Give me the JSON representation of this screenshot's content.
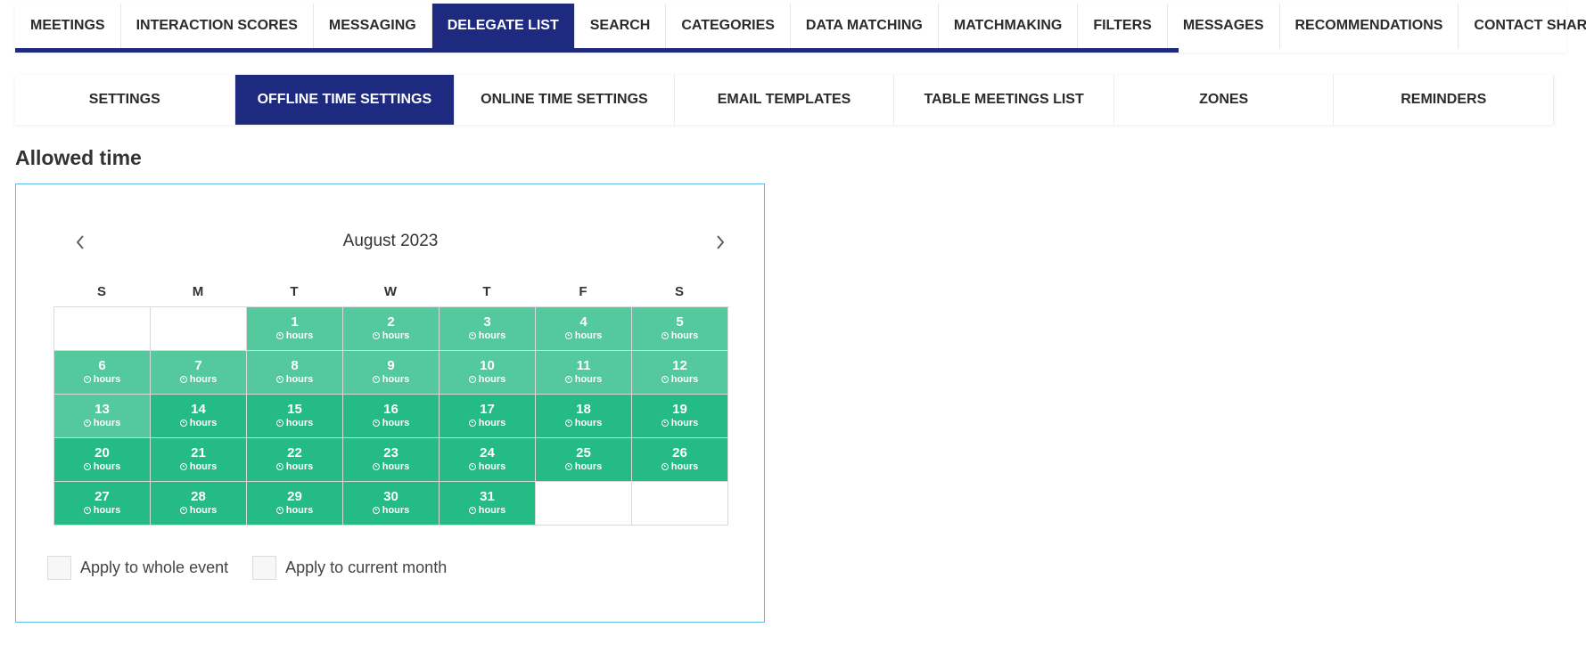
{
  "top_tabs": [
    {
      "label": "MEETINGS",
      "active": false
    },
    {
      "label": "INTERACTION SCORES",
      "active": false
    },
    {
      "label": "MESSAGING",
      "active": false
    },
    {
      "label": "DELEGATE LIST",
      "active": true
    },
    {
      "label": "SEARCH",
      "active": false
    },
    {
      "label": "CATEGORIES",
      "active": false
    },
    {
      "label": "DATA MATCHING",
      "active": false
    },
    {
      "label": "MATCHMAKING",
      "active": false
    },
    {
      "label": "FILTERS",
      "active": false
    },
    {
      "label": "MESSAGES",
      "active": false
    },
    {
      "label": "RECOMMENDATIONS",
      "active": false
    },
    {
      "label": "CONTACT SHARING",
      "active": false
    }
  ],
  "sub_tabs": [
    {
      "label": "SETTINGS",
      "active": false
    },
    {
      "label": "OFFLINE TIME SETTINGS",
      "active": true
    },
    {
      "label": "ONLINE TIME SETTINGS",
      "active": false
    },
    {
      "label": "EMAIL TEMPLATES",
      "active": false
    },
    {
      "label": "TABLE MEETINGS LIST",
      "active": false
    },
    {
      "label": "ZONES",
      "active": false
    },
    {
      "label": "REMINDERS",
      "active": false
    }
  ],
  "section_title": "Allowed time",
  "calendar": {
    "month_label": "August 2023",
    "weekdays": [
      "S",
      "M",
      "T",
      "W",
      "T",
      "F",
      "S"
    ],
    "hours_label": "hours",
    "days": [
      {
        "day": "",
        "state": "empty"
      },
      {
        "day": "",
        "state": "empty"
      },
      {
        "day": "1",
        "state": "light"
      },
      {
        "day": "2",
        "state": "light"
      },
      {
        "day": "3",
        "state": "light"
      },
      {
        "day": "4",
        "state": "light"
      },
      {
        "day": "5",
        "state": "light"
      },
      {
        "day": "6",
        "state": "light"
      },
      {
        "day": "7",
        "state": "light"
      },
      {
        "day": "8",
        "state": "light"
      },
      {
        "day": "9",
        "state": "light"
      },
      {
        "day": "10",
        "state": "light"
      },
      {
        "day": "11",
        "state": "light"
      },
      {
        "day": "12",
        "state": "light"
      },
      {
        "day": "13",
        "state": "light"
      },
      {
        "day": "14",
        "state": "dark"
      },
      {
        "day": "15",
        "state": "dark"
      },
      {
        "day": "16",
        "state": "dark"
      },
      {
        "day": "17",
        "state": "dark"
      },
      {
        "day": "18",
        "state": "dark"
      },
      {
        "day": "19",
        "state": "dark"
      },
      {
        "day": "20",
        "state": "dark"
      },
      {
        "day": "21",
        "state": "dark"
      },
      {
        "day": "22",
        "state": "dark"
      },
      {
        "day": "23",
        "state": "dark"
      },
      {
        "day": "24",
        "state": "dark"
      },
      {
        "day": "25",
        "state": "dark"
      },
      {
        "day": "26",
        "state": "dark"
      },
      {
        "day": "27",
        "state": "dark"
      },
      {
        "day": "28",
        "state": "dark"
      },
      {
        "day": "29",
        "state": "dark"
      },
      {
        "day": "30",
        "state": "dark"
      },
      {
        "day": "31",
        "state": "dark"
      },
      {
        "day": "",
        "state": "empty"
      },
      {
        "day": "",
        "state": "empty"
      }
    ]
  },
  "options": {
    "whole_event_label": "Apply to whole event",
    "current_month_label": "Apply to current month"
  },
  "colors": {
    "accent": "#1d2a7f",
    "light_green": "#54c99d",
    "dark_green": "#24bb84",
    "panel_border": "#5bb8e8"
  },
  "icons": {
    "prev": "chevron-left-icon",
    "next": "chevron-right-icon",
    "clock": "clock-icon"
  }
}
